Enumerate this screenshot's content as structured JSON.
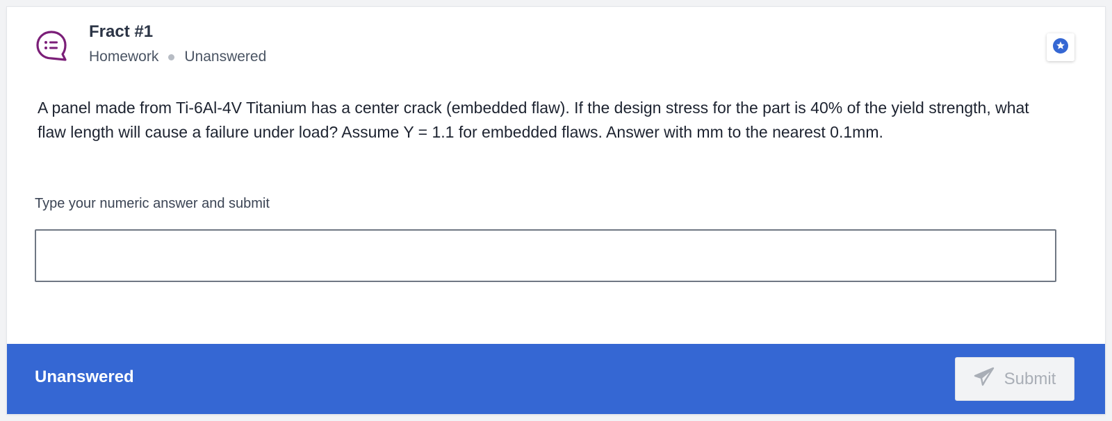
{
  "question": {
    "title": "Fract #1",
    "category": "Homework",
    "status": "Unanswered",
    "text": "A panel made from Ti-6Al-4V Titanium has a center crack (embedded flaw). If the design stress for the part is 40% of the yield strength, what flaw length will cause a failure under load? Assume Y = 1.1 for embedded flaws. Answer with mm to the nearest 0.1mm.",
    "icon": "discussion-bubble-icon"
  },
  "answer": {
    "prompt": "Type your numeric answer and submit",
    "value": "",
    "placeholder": ""
  },
  "footer": {
    "status": "Unanswered",
    "submit_label": "Submit",
    "submit_icon": "paper-plane-icon"
  },
  "colors": {
    "accent": "#3567d3",
    "icon_purple": "#7b1f78",
    "star_blue": "#3567d3"
  }
}
